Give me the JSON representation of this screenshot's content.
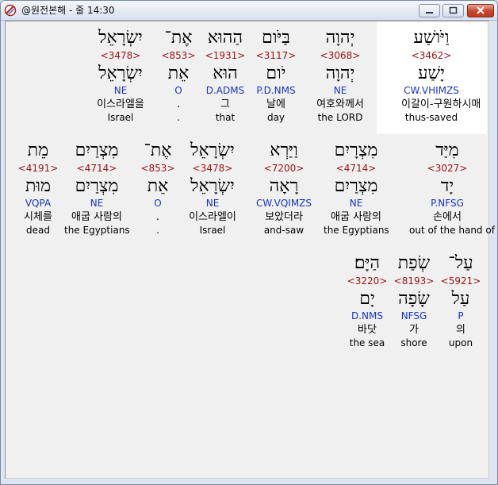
{
  "window": {
    "title": "@원전본해 - 줄 14:30"
  },
  "interlinear": {
    "line1": [
      {
        "heb": "וַיֹּושַׁע",
        "strong": "<3462>",
        "lemma": "יָשַׁע",
        "morph": "CW.VHIMZS",
        "kor": "이갈이-구원하시매",
        "eng": "thus-saved"
      },
      {
        "heb": "יְהוָה",
        "strong": "<3068>",
        "lemma": "יְהוָה",
        "morph": "NE",
        "kor": "여호와께서",
        "eng": "the LORD"
      },
      {
        "heb": "בַּיֹּום",
        "strong": "<3117>",
        "lemma": "יֹום",
        "morph": "P.D.NMS",
        "kor": "날에",
        "eng": "day"
      },
      {
        "heb": "הַהוּא",
        "strong": "<1931>",
        "lemma": "הוּא",
        "morph": "D.ADMS",
        "kor": "그",
        "eng": "that"
      },
      {
        "heb": "אֶת־",
        "strong": "<853>",
        "lemma": "אֵת",
        "morph": "O",
        "kor": ".",
        "eng": "."
      },
      {
        "heb": "יִשְׂרָאֵל",
        "strong": "<3478>",
        "lemma": "יִשְׂרָאֵל",
        "morph": "NE",
        "kor": "이스라엘을",
        "eng": "Israel"
      }
    ],
    "line2": [
      {
        "heb": "מִיַּד",
        "strong": "<3027>",
        "lemma": "יָד",
        "morph": "P.NFSG",
        "kor": "손에서",
        "eng": "out of the hand of"
      },
      {
        "heb": "מִצְרָיִם",
        "strong": "<4714>",
        "lemma": "מִצְרַיִם",
        "morph": "NE",
        "kor": "애굽 사람의",
        "eng": "the Egyptians"
      },
      {
        "heb": "וַיַּרְא",
        "strong": "<7200>",
        "lemma": "רָאָה",
        "morph": "CW.VQIMZS",
        "kor": "보았더라",
        "eng": "and-saw"
      },
      {
        "heb": "יִשְׂרָאֵל",
        "strong": "<3478>",
        "lemma": "יִשְׂרָאֵל",
        "morph": "NE",
        "kor": "이스라엘이",
        "eng": "Israel"
      },
      {
        "heb": "אֶת־",
        "strong": "<853>",
        "lemma": "אֵת",
        "morph": "O",
        "kor": ".",
        "eng": "."
      },
      {
        "heb": "מִצְרַיִם",
        "strong": "<4714>",
        "lemma": "מִצְרַיִם",
        "morph": "NE",
        "kor": "애굽 사람의",
        "eng": "the Egyptians"
      },
      {
        "heb": "מֵת",
        "strong": "<4191>",
        "lemma": "מוּת",
        "morph": "VQPA",
        "kor": "시체를",
        "eng": "dead"
      }
    ],
    "line3": [
      {
        "heb": "עַל־",
        "strong": "<5921>",
        "lemma": "עַל",
        "morph": "P",
        "kor": "의",
        "eng": "upon"
      },
      {
        "heb": "שְׂפַת",
        "strong": "<8193>",
        "lemma": "שָׂפָה",
        "morph": "NFSG",
        "kor": "가",
        "eng": "shore"
      },
      {
        "heb": "הַיָּם׃",
        "strong": "<3220>",
        "lemma": "יָם",
        "morph": "D.NMS",
        "kor": "바닷",
        "eng": "the sea"
      }
    ]
  }
}
